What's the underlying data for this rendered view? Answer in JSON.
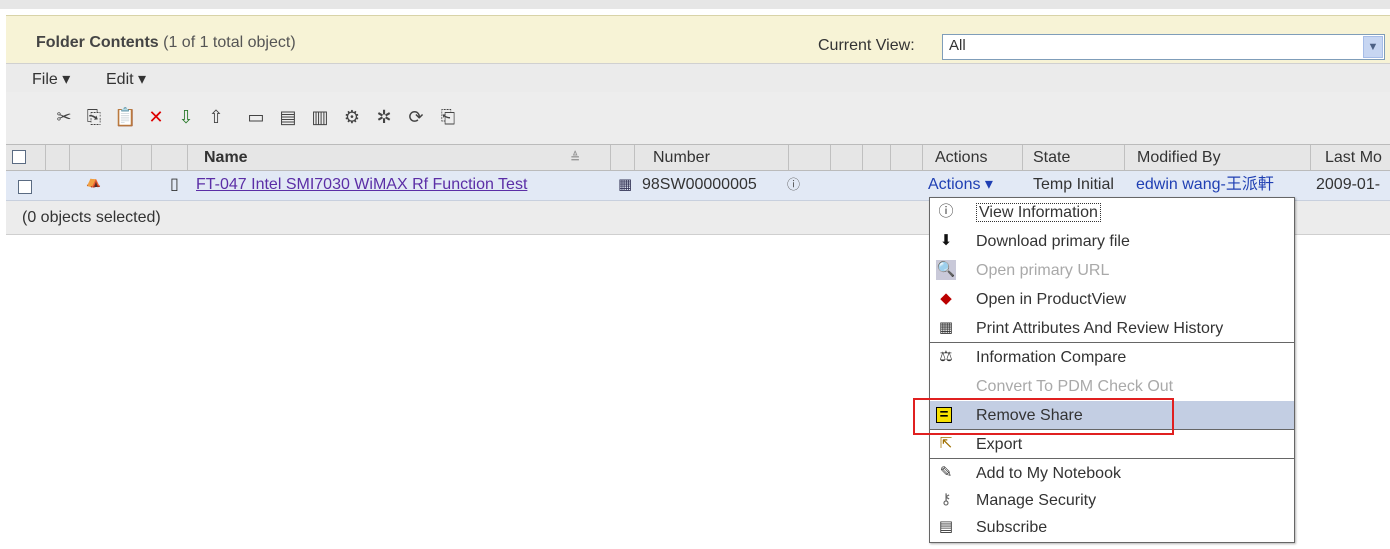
{
  "folder": {
    "title": "Folder Contents",
    "count_text": "(1 of 1 total object)",
    "current_view_label": "Current View:",
    "current_view_value": "All"
  },
  "menubar": {
    "file": "File ▾",
    "edit": "Edit ▾"
  },
  "toolbar": {
    "icons": [
      "cut-icon",
      "copy-icon",
      "paste-icon",
      "delete-icon",
      "checkout-icon",
      "checkin-icon",
      "new-folder-icon",
      "new-document-icon",
      "new-part-icon",
      "settings-icon",
      "multi-settings-icon",
      "refresh-icon",
      "new-item-icon"
    ]
  },
  "table": {
    "headers": {
      "name": "Name",
      "number": "Number",
      "actions": "Actions",
      "state": "State",
      "modified_by": "Modified By",
      "last_modified": "Last Mo"
    },
    "row": {
      "name": "FT-047 Intel SMI7030 WiMAX Rf Function Test",
      "number": "98SW00000005",
      "actions": "Actions ▾",
      "state": "Temp Initial",
      "modified_by": "edwin wang-王派軒",
      "last_modified": "2009-01-"
    },
    "selection_status": "(0 objects selected)"
  },
  "action_menu": {
    "items": [
      {
        "label": "View Information",
        "icon": "info-icon",
        "disabled": false
      },
      {
        "label": "Download primary file",
        "icon": "download-icon",
        "disabled": false
      },
      {
        "label": "Open primary URL",
        "icon": "url-icon",
        "disabled": true
      },
      {
        "label": "Open in ProductView",
        "icon": "productview-icon",
        "disabled": false
      },
      {
        "label": "Print Attributes And Review History",
        "icon": "print-icon",
        "disabled": false
      },
      {
        "label": "Information Compare",
        "icon": "compare-icon",
        "disabled": false
      },
      {
        "label": "Convert To PDM Check Out",
        "icon": "",
        "disabled": true
      },
      {
        "label": "Remove Share",
        "icon": "remove-share-icon",
        "disabled": false
      },
      {
        "label": "Export",
        "icon": "export-icon",
        "disabled": false
      },
      {
        "label": "Add to My Notebook",
        "icon": "notebook-icon",
        "disabled": false
      },
      {
        "label": "Manage Security",
        "icon": "key-icon",
        "disabled": false
      },
      {
        "label": "Subscribe",
        "icon": "subscribe-icon",
        "disabled": false
      }
    ]
  },
  "colors": {
    "header_bg": "#f7f3d6",
    "row_bg": "#e2e9f5",
    "highlight": "#c3cee3",
    "annotation": "#e02020",
    "link": "#5b2ea6"
  }
}
